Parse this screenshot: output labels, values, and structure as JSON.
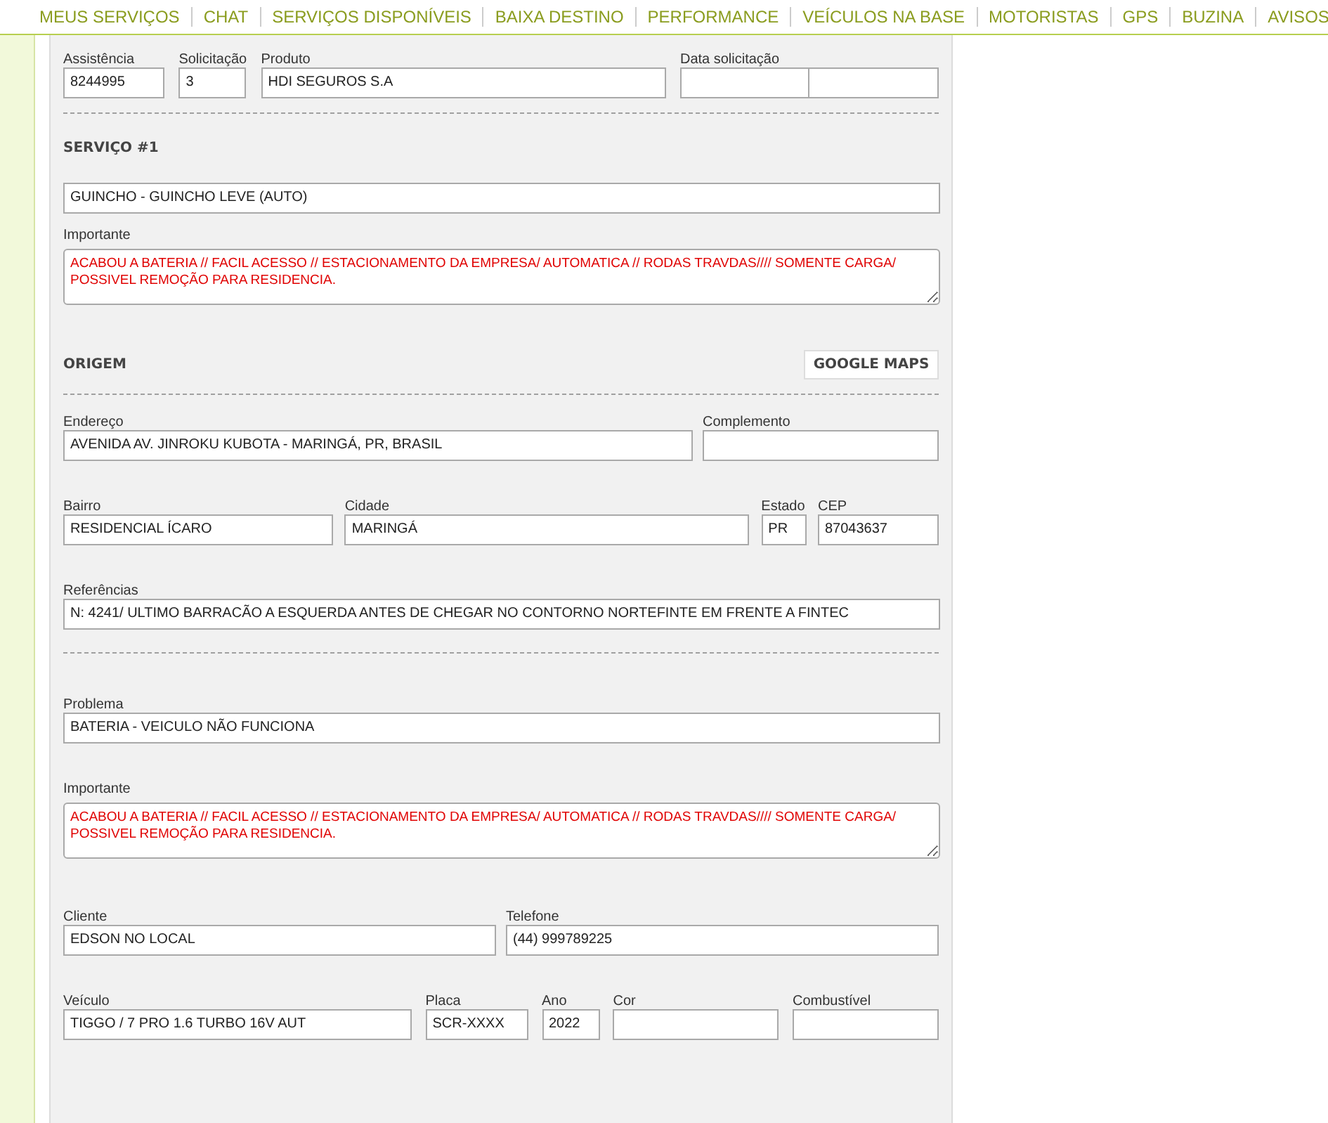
{
  "nav": [
    "MEUS SERVIÇOS",
    "CHAT",
    "SERVIÇOS DISPONÍVEIS",
    "BAIXA DESTINO",
    "PERFORMANCE",
    "VEÍCULOS NA BASE",
    "MOTORISTAS",
    "GPS",
    "BUZINA",
    "AVISOS"
  ],
  "blocks": [
    {
      "kind": "fields",
      "fields": [
        {
          "label": "Assistência",
          "value": "8244995"
        },
        {
          "label": "Solicitação",
          "value": "3"
        },
        {
          "label": "Produto",
          "value": "HDI SEGUROS S.A"
        },
        {
          "label": "Data solicitação",
          "kind": "datetime"
        }
      ]
    },
    {
      "kind": "divider"
    },
    {
      "kind": "heading",
      "title": "SERVIÇO #1"
    },
    {
      "kind": "fields",
      "fields": [
        {
          "value": "GUINCHO - GUINCHO LEVE (AUTO)"
        }
      ]
    },
    {
      "kind": "textarea",
      "label": "Importante",
      "value": "ACABOU A BATERIA // FACIL ACESSO // ESTACIONAMENTO DA EMPRESA/ AUTOMATICA // RODAS TRAVDAS//// SOMENTE CARGA/ POSSIVEL REMOÇÃO PARA RESIDENCIA."
    },
    {
      "kind": "heading",
      "title": "ORIGEM",
      "button": "GOOGLE MAPS"
    },
    {
      "kind": "divider"
    },
    {
      "kind": "fields",
      "fields": [
        {
          "label": "Endereço",
          "value": "AVENIDA AV. JINROKU KUBOTA - MARINGÁ, PR, BRASIL"
        },
        {
          "label": "Complemento"
        }
      ]
    },
    {
      "kind": "fields",
      "fields": [
        {
          "label": "Bairro",
          "value": "RESIDENCIAL ÍCARO"
        },
        {
          "label": "Cidade",
          "value": "MARINGÁ"
        },
        {
          "label": "Estado",
          "value": "PR"
        },
        {
          "label": "CEP",
          "value": "87043637"
        }
      ]
    },
    {
      "kind": "fields",
      "fields": [
        {
          "label": "Referências",
          "value": "N: 4241/ ULTIMO BARRACÃO A ESQUERDA ANTES DE CHEGAR NO CONTORNO NORTEFINTE EM FRENTE A FINTEC"
        }
      ]
    },
    {
      "kind": "divider"
    },
    {
      "kind": "fields",
      "fields": [
        {
          "label": "Problema",
          "value": "BATERIA - VEICULO NÃO FUNCIONA"
        }
      ]
    },
    {
      "kind": "textarea",
      "label": "Importante",
      "value": "ACABOU A BATERIA // FACIL ACESSO // ESTACIONAMENTO DA EMPRESA/ AUTOMATICA // RODAS TRAVDAS//// SOMENTE CARGA/ POSSIVEL REMOÇÃO PARA RESIDENCIA."
    },
    {
      "kind": "fields",
      "fields": [
        {
          "label": "Cliente",
          "value": "EDSON NO LOCAL"
        },
        {
          "label": "Telefone",
          "value": "(44) 999789225"
        }
      ]
    },
    {
      "kind": "fields",
      "fields": [
        {
          "label": "Veículo",
          "value": "TIGGO / 7 PRO 1.6 TURBO 16V AUT"
        },
        {
          "label": "Placa",
          "value": "SCR-XXXX"
        },
        {
          "label": "Ano",
          "value": "2022"
        },
        {
          "label": "Cor"
        },
        {
          "label": "Combustível"
        }
      ]
    }
  ]
}
